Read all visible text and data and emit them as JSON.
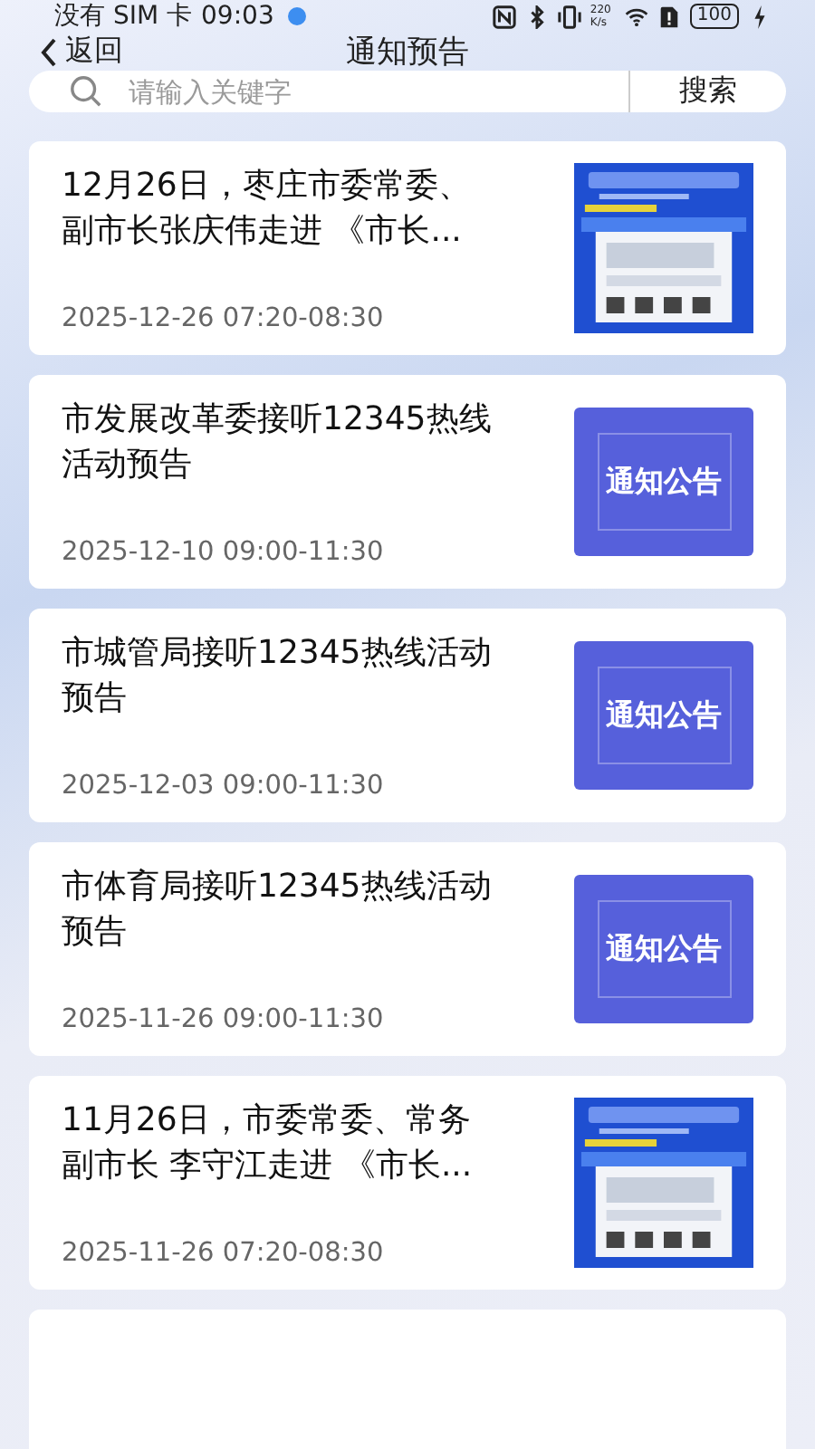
{
  "status_bar": {
    "carrier": "没有 SIM 卡",
    "time": "09:03",
    "speed": "220\nK/s",
    "battery": "100"
  },
  "nav": {
    "back": "返回",
    "title": "通知预告"
  },
  "search": {
    "placeholder": "请输入关键字",
    "button": "搜索"
  },
  "items": [
    {
      "title": "12月26日，枣庄市委常委、副市长张庆伟走进 《市长...",
      "time": "2025-12-26 07:20-08:30"
    },
    {
      "title": "市发展改革委接听12345热线活动预告",
      "time": "2025-12-10 09:00-11:30",
      "thumb": {
        "kind": "notice",
        "text": "通知公告"
      }
    },
    {
      "title": "市城管局接听12345热线活动预告",
      "time": "2025-12-03 09:00-11:30",
      "thumb": {
        "kind": "notice",
        "text": "通知公告"
      }
    },
    {
      "title": "市体育局接听12345热线活动预告",
      "time": "2025-11-26 09:00-11:30",
      "thumb": {
        "kind": "notice",
        "text": "通知公告"
      }
    },
    {
      "title": "11月26日，市委常委、常务副市长 李守江走进 《市长...",
      "time": "2025-11-26 07:20-08:30"
    }
  ]
}
